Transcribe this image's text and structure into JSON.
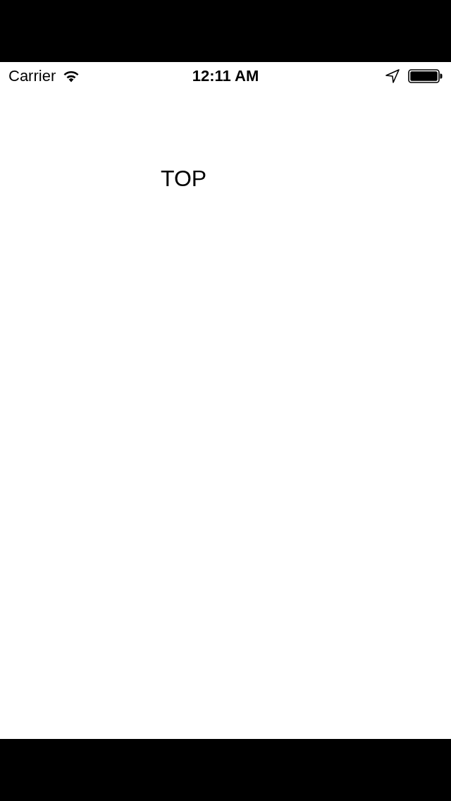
{
  "status_bar": {
    "carrier": "Carrier",
    "time": "12:11 AM"
  },
  "content": {
    "label": "TOP"
  }
}
